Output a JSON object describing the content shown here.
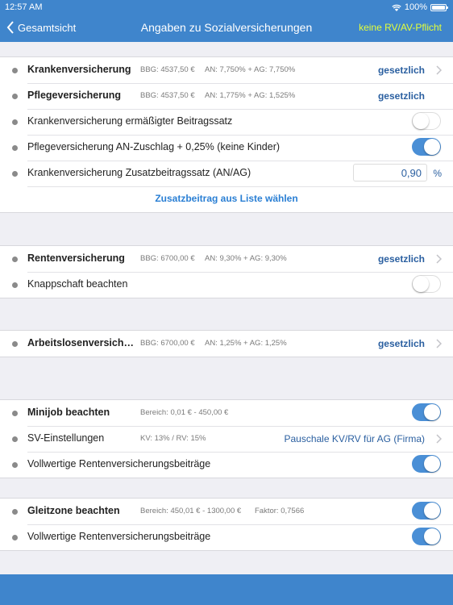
{
  "status": {
    "time": "12:57 AM",
    "battery": "100%"
  },
  "nav": {
    "back": "Gesamtsicht",
    "title": "Angaben zu Sozialversicherungen",
    "right": "keine RV/AV-Pflicht"
  },
  "sec1": {
    "kv": {
      "label": "Krankenversicherung",
      "bbg": "BBG: 4537,50 €",
      "rate": "AN: 7,750% + AG: 7,750%",
      "value": "gesetzlich"
    },
    "pv": {
      "label": "Pflegeversicherung",
      "bbg": "BBG: 4537,50 €",
      "rate": "AN: 1,775% + AG: 1,525%",
      "value": "gesetzlich"
    },
    "kv_erm": {
      "label": "Krankenversicherung ermäßigter Beitragssatz",
      "on": false
    },
    "pv_zus": {
      "label": "Pflegeversicherung AN-Zuschlag + 0,25% (keine Kinder)",
      "on": true
    },
    "kv_zus": {
      "label": "Krankenversicherung Zusatzbeitragssatz (AN/AG)",
      "value": "0,90",
      "unit": "%"
    },
    "link": "Zusatzbeitrag aus Liste wählen"
  },
  "sec2": {
    "rv": {
      "label": "Rentenversicherung",
      "bbg": "BBG: 6700,00 €",
      "rate": "AN: 9,30% + AG: 9,30%",
      "value": "gesetzlich"
    },
    "knapp": {
      "label": "Knappschaft beachten",
      "on": false
    }
  },
  "sec3": {
    "av": {
      "label": "Arbeitslosenversich…",
      "bbg": "BBG: 6700,00 €",
      "rate": "AN: 1,25% + AG: 1,25%",
      "value": "gesetzlich"
    }
  },
  "sec4": {
    "mini": {
      "label": "Minijob beachten",
      "info": "Bereich: 0,01 € - 450,00 €",
      "on": true
    },
    "sv": {
      "label": "SV-Einstellungen",
      "info": "KV: 13% / RV: 15%",
      "value": "Pauschale KV/RV für AG (Firma)"
    },
    "voll": {
      "label": "Vollwertige Rentenversicherungsbeiträge",
      "on": true
    }
  },
  "sec5": {
    "gleit": {
      "label": "Gleitzone beachten",
      "info": "Bereich: 450,01 € - 1300,00 €",
      "factor": "Faktor: 0,7566",
      "on": true
    },
    "voll": {
      "label": "Vollwertige Rentenversicherungsbeiträge",
      "on": true
    }
  },
  "colors": {
    "bar": "#3f85cc",
    "accent": "#4a8fd6",
    "warning_text": "#e4ff3a"
  }
}
